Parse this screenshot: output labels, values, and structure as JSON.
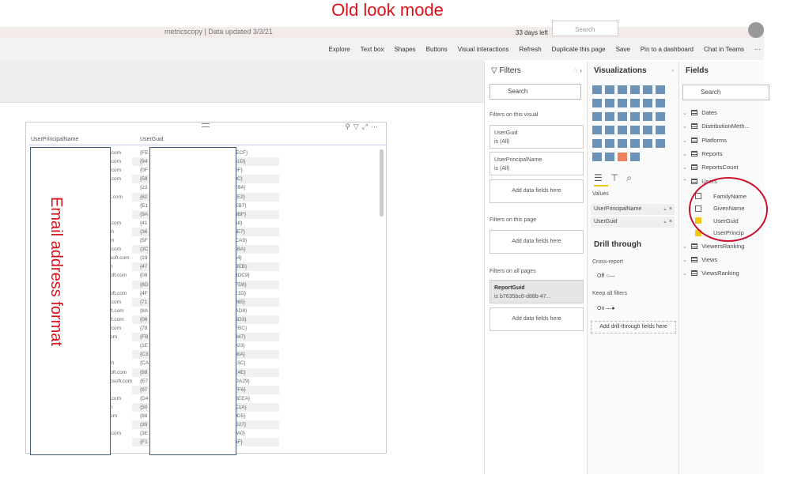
{
  "annotation": {
    "title": "Old look mode",
    "overlay_text": "Email address format"
  },
  "topbar": {
    "filename": "metricscopy | Data updated 3/3/21",
    "trial": "33 days left",
    "search_placeholder": "Search"
  },
  "toolbar": {
    "items": [
      "Explore",
      "Text box",
      "Shapes",
      "Buttons",
      "Visual interactions",
      "Refresh",
      "Duplicate this page",
      "Save",
      "Pin to a dashboard",
      "Chat in Teams",
      "···"
    ]
  },
  "table": {
    "headers": [
      "UserPrincipalName",
      "UserGuid"
    ],
    "rows": [
      [
        ".com",
        "{FE",
        "DAECF}"
      ],
      [
        ".com",
        "{94",
        "9761D}"
      ],
      [
        ".com",
        "{0F",
        "FF0F}"
      ],
      [
        ".com",
        "{58",
        "600C}"
      ],
      [
        "",
        "{23",
        "36FB4}"
      ],
      [
        "t.com",
        "{62",
        "121E2}"
      ],
      [
        "",
        "{E1",
        "7EEB7}"
      ],
      [
        "",
        "{9A",
        "E39BF}"
      ],
      [
        ".com",
        "{41",
        "54A8}"
      ],
      [
        "m",
        "{36",
        "006E7}"
      ],
      [
        "m",
        "{5F",
        "D4CA9}"
      ],
      [
        ".com",
        "{3C",
        "964BA}"
      ],
      [
        "soft.com",
        "{19",
        "3564}"
      ],
      [
        "n",
        "{47",
        "AB9EB}"
      ],
      [
        "oft.com",
        "{08",
        "93BDC9}"
      ],
      [
        "",
        "{8D",
        "C4FD8}"
      ],
      [
        "oft.com",
        "{4F",
        "57E1D}"
      ],
      [
        ".com",
        "{71",
        "0A065}"
      ],
      [
        "ft.com",
        "{8A",
        "5DAD8}"
      ],
      [
        "ft.com",
        "{06",
        "C65D3}"
      ],
      [
        ".com",
        "{78",
        "A7FBC}"
      ],
      [
        "om",
        "{FB",
        "2C847}"
      ],
      [
        "",
        "{1E",
        "60023}"
      ],
      [
        "",
        "{C3",
        "2736A}"
      ],
      [
        "m",
        "{CA",
        "1413C}"
      ],
      [
        "oft.com",
        "{98",
        "26E4E}"
      ],
      [
        "osoft.com",
        "{E7",
        "7CDA29}"
      ],
      [
        "",
        "{97",
        "E9FF6}"
      ],
      [
        ".com",
        "{D4",
        "99DEEA}"
      ],
      [
        "n",
        "{50",
        "FAC1A}"
      ],
      [
        "om",
        "{88",
        "880D5}"
      ],
      [
        "",
        "{39",
        "E5D27}"
      ],
      [
        ".com",
        "{3E",
        "959A0}"
      ],
      [
        "",
        "{F1",
        "35AF}"
      ]
    ]
  },
  "filters": {
    "title": "Filters",
    "search": "Search",
    "on_visual": "Filters on this visual",
    "card1_name": "UserGuid",
    "card1_val": "is (All)",
    "card2_name": "UserPrincipalName",
    "card2_val": "is (All)",
    "add": "Add data fields here",
    "on_page": "Filters on this page",
    "on_all": "Filters on all pages",
    "card3_name": "ReportGuid",
    "card3_val": "is b7635bc6-d88b-47...",
    "more": "..."
  },
  "viz": {
    "title": "Visualizations",
    "values_label": "Values",
    "wells": [
      "UserPrincipalName",
      "UserGuid"
    ],
    "drill": "Drill through",
    "cross": "Cross-report",
    "off": "Off",
    "keep": "Keep all filters",
    "on": "On",
    "add_drill": "Add drill-through fields here",
    "more": "..."
  },
  "fields": {
    "title": "Fields",
    "search": "Search",
    "tables_before": [
      "Dates",
      "DistributionMeth...",
      "Platforms",
      "Reports",
      "ReportsCount",
      "Users"
    ],
    "user_fields": [
      {
        "name": "FamilyName",
        "checked": false
      },
      {
        "name": "GivenName",
        "checked": false
      },
      {
        "name": "UserGuid",
        "checked": true
      },
      {
        "name": "UserPrincip",
        "checked": true
      }
    ],
    "tables_after": [
      "ViewersRanking",
      "Views",
      "ViewsRanking"
    ]
  },
  "colors": {
    "annotation": "#d9141b",
    "accent": "#f2c811"
  }
}
